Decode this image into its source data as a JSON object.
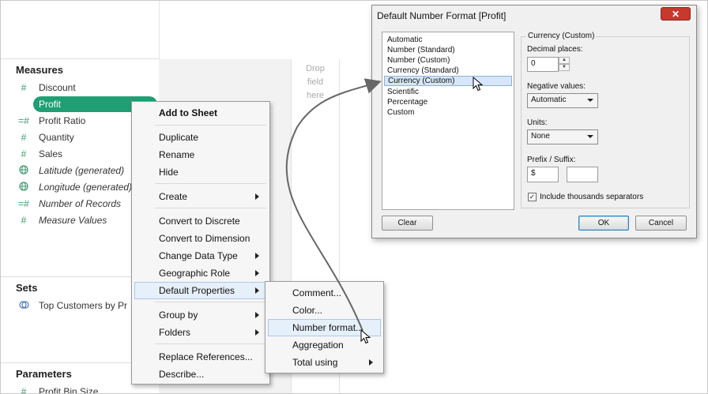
{
  "data_pane": {
    "measures_header": "Measures",
    "measures": [
      {
        "icon": "number-icon",
        "label": "Discount",
        "italic": false
      },
      {
        "icon": "number-icon",
        "label": "Profit",
        "italic": false
      },
      {
        "icon": "calc-number-icon",
        "label": "Profit Ratio",
        "italic": false
      },
      {
        "icon": "number-icon",
        "label": "Quantity",
        "italic": false
      },
      {
        "icon": "number-icon",
        "label": "Sales",
        "italic": false
      },
      {
        "icon": "globe-icon",
        "label": "Latitude (generated)",
        "italic": true
      },
      {
        "icon": "globe-icon",
        "label": "Longitude (generated)",
        "italic": true
      },
      {
        "icon": "calc-number-icon",
        "label": "Number of Records",
        "italic": true
      },
      {
        "icon": "number-icon",
        "label": "Measure Values",
        "italic": true
      }
    ],
    "sets_header": "Sets",
    "sets": [
      {
        "icon": "set-icon",
        "label": "Top Customers by Pr"
      }
    ],
    "parameters_header": "Parameters",
    "parameters": [
      {
        "icon": "number-icon",
        "label": "Profit Bin Size"
      }
    ]
  },
  "shelf": {
    "drop_hint": [
      "Drop",
      "field",
      "here"
    ]
  },
  "context_menu": {
    "items": {
      "add_to_sheet": "Add to Sheet",
      "duplicate": "Duplicate",
      "rename": "Rename",
      "hide": "Hide",
      "create": "Create",
      "convert_discrete": "Convert to Discrete",
      "convert_dimension": "Convert to Dimension",
      "change_data_type": "Change Data Type",
      "geographic_role": "Geographic Role",
      "default_properties": "Default Properties",
      "group_by": "Group by",
      "folders": "Folders",
      "replace_references": "Replace References...",
      "describe": "Describe..."
    }
  },
  "submenu": {
    "comment": "Comment...",
    "color": "Color...",
    "number_format": "Number format...",
    "aggregation": "Aggregation",
    "total_using": "Total using"
  },
  "dialog": {
    "title": "Default Number Format [Profit]",
    "close_glyph": "✕",
    "formats": [
      "Automatic",
      "Number (Standard)",
      "Number (Custom)",
      "Currency (Standard)",
      "Currency (Custom)",
      "Scientific",
      "Percentage",
      "Custom"
    ],
    "selected_format": "Currency (Custom)",
    "group_title": "Currency (Custom)",
    "decimal_label": "Decimal places:",
    "decimal_value": "0",
    "negative_label": "Negative values:",
    "negative_value": "Automatic",
    "units_label": "Units:",
    "units_value": "None",
    "prefix_label": "Prefix / Suffix:",
    "prefix_value": "$",
    "suffix_value": "",
    "thousands_label": "Include thousands separators",
    "thousands_checked": true,
    "clear_button": "Clear",
    "ok_button": "OK",
    "cancel_button": "Cancel"
  },
  "colors": {
    "pill": "#1f9f73",
    "field_icon": "#3d9a6f",
    "close": "#c7382d"
  }
}
